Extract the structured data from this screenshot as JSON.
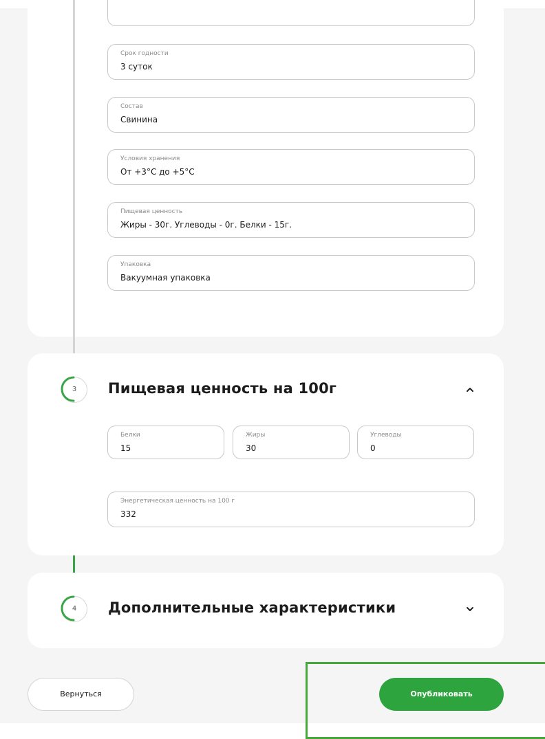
{
  "section2": {
    "fields": [
      {
        "label": "",
        "value": ""
      },
      {
        "label": "Срок годности",
        "value": "3 суток"
      },
      {
        "label": "Состав",
        "value": "Свинина"
      },
      {
        "label": "Условия хранения",
        "value": "От +3°С до +5°С"
      },
      {
        "label": "Пищевая ценность",
        "value": "Жиры - 30г. Углеводы - 0г. Белки - 15г."
      },
      {
        "label": "Упаковка",
        "value": "Вакуумная упаковка"
      }
    ]
  },
  "section3": {
    "number": "3",
    "title": "Пищевая ценность на 100г",
    "expanded": true,
    "chevron_icon": "chevron-up-icon",
    "proteins": {
      "label": "Белки",
      "value": "15"
    },
    "fats": {
      "label": "Жиры",
      "value": "30"
    },
    "carbs": {
      "label": "Углеводы",
      "value": "0"
    },
    "energy": {
      "label": "Энергетическая ценность на 100 г",
      "value": "332"
    }
  },
  "section4": {
    "number": "4",
    "title": "Дополнительные характеристики",
    "expanded": false,
    "chevron_icon": "chevron-down-icon"
  },
  "actions": {
    "back_label": "Вернуться",
    "publish_label": "Опубликовать"
  },
  "colors": {
    "accent_green": "#2ea43e",
    "highlight_border": "#45a83a",
    "step_line_grey": "#d4d4d4",
    "page_background": "#f5f5f6"
  }
}
